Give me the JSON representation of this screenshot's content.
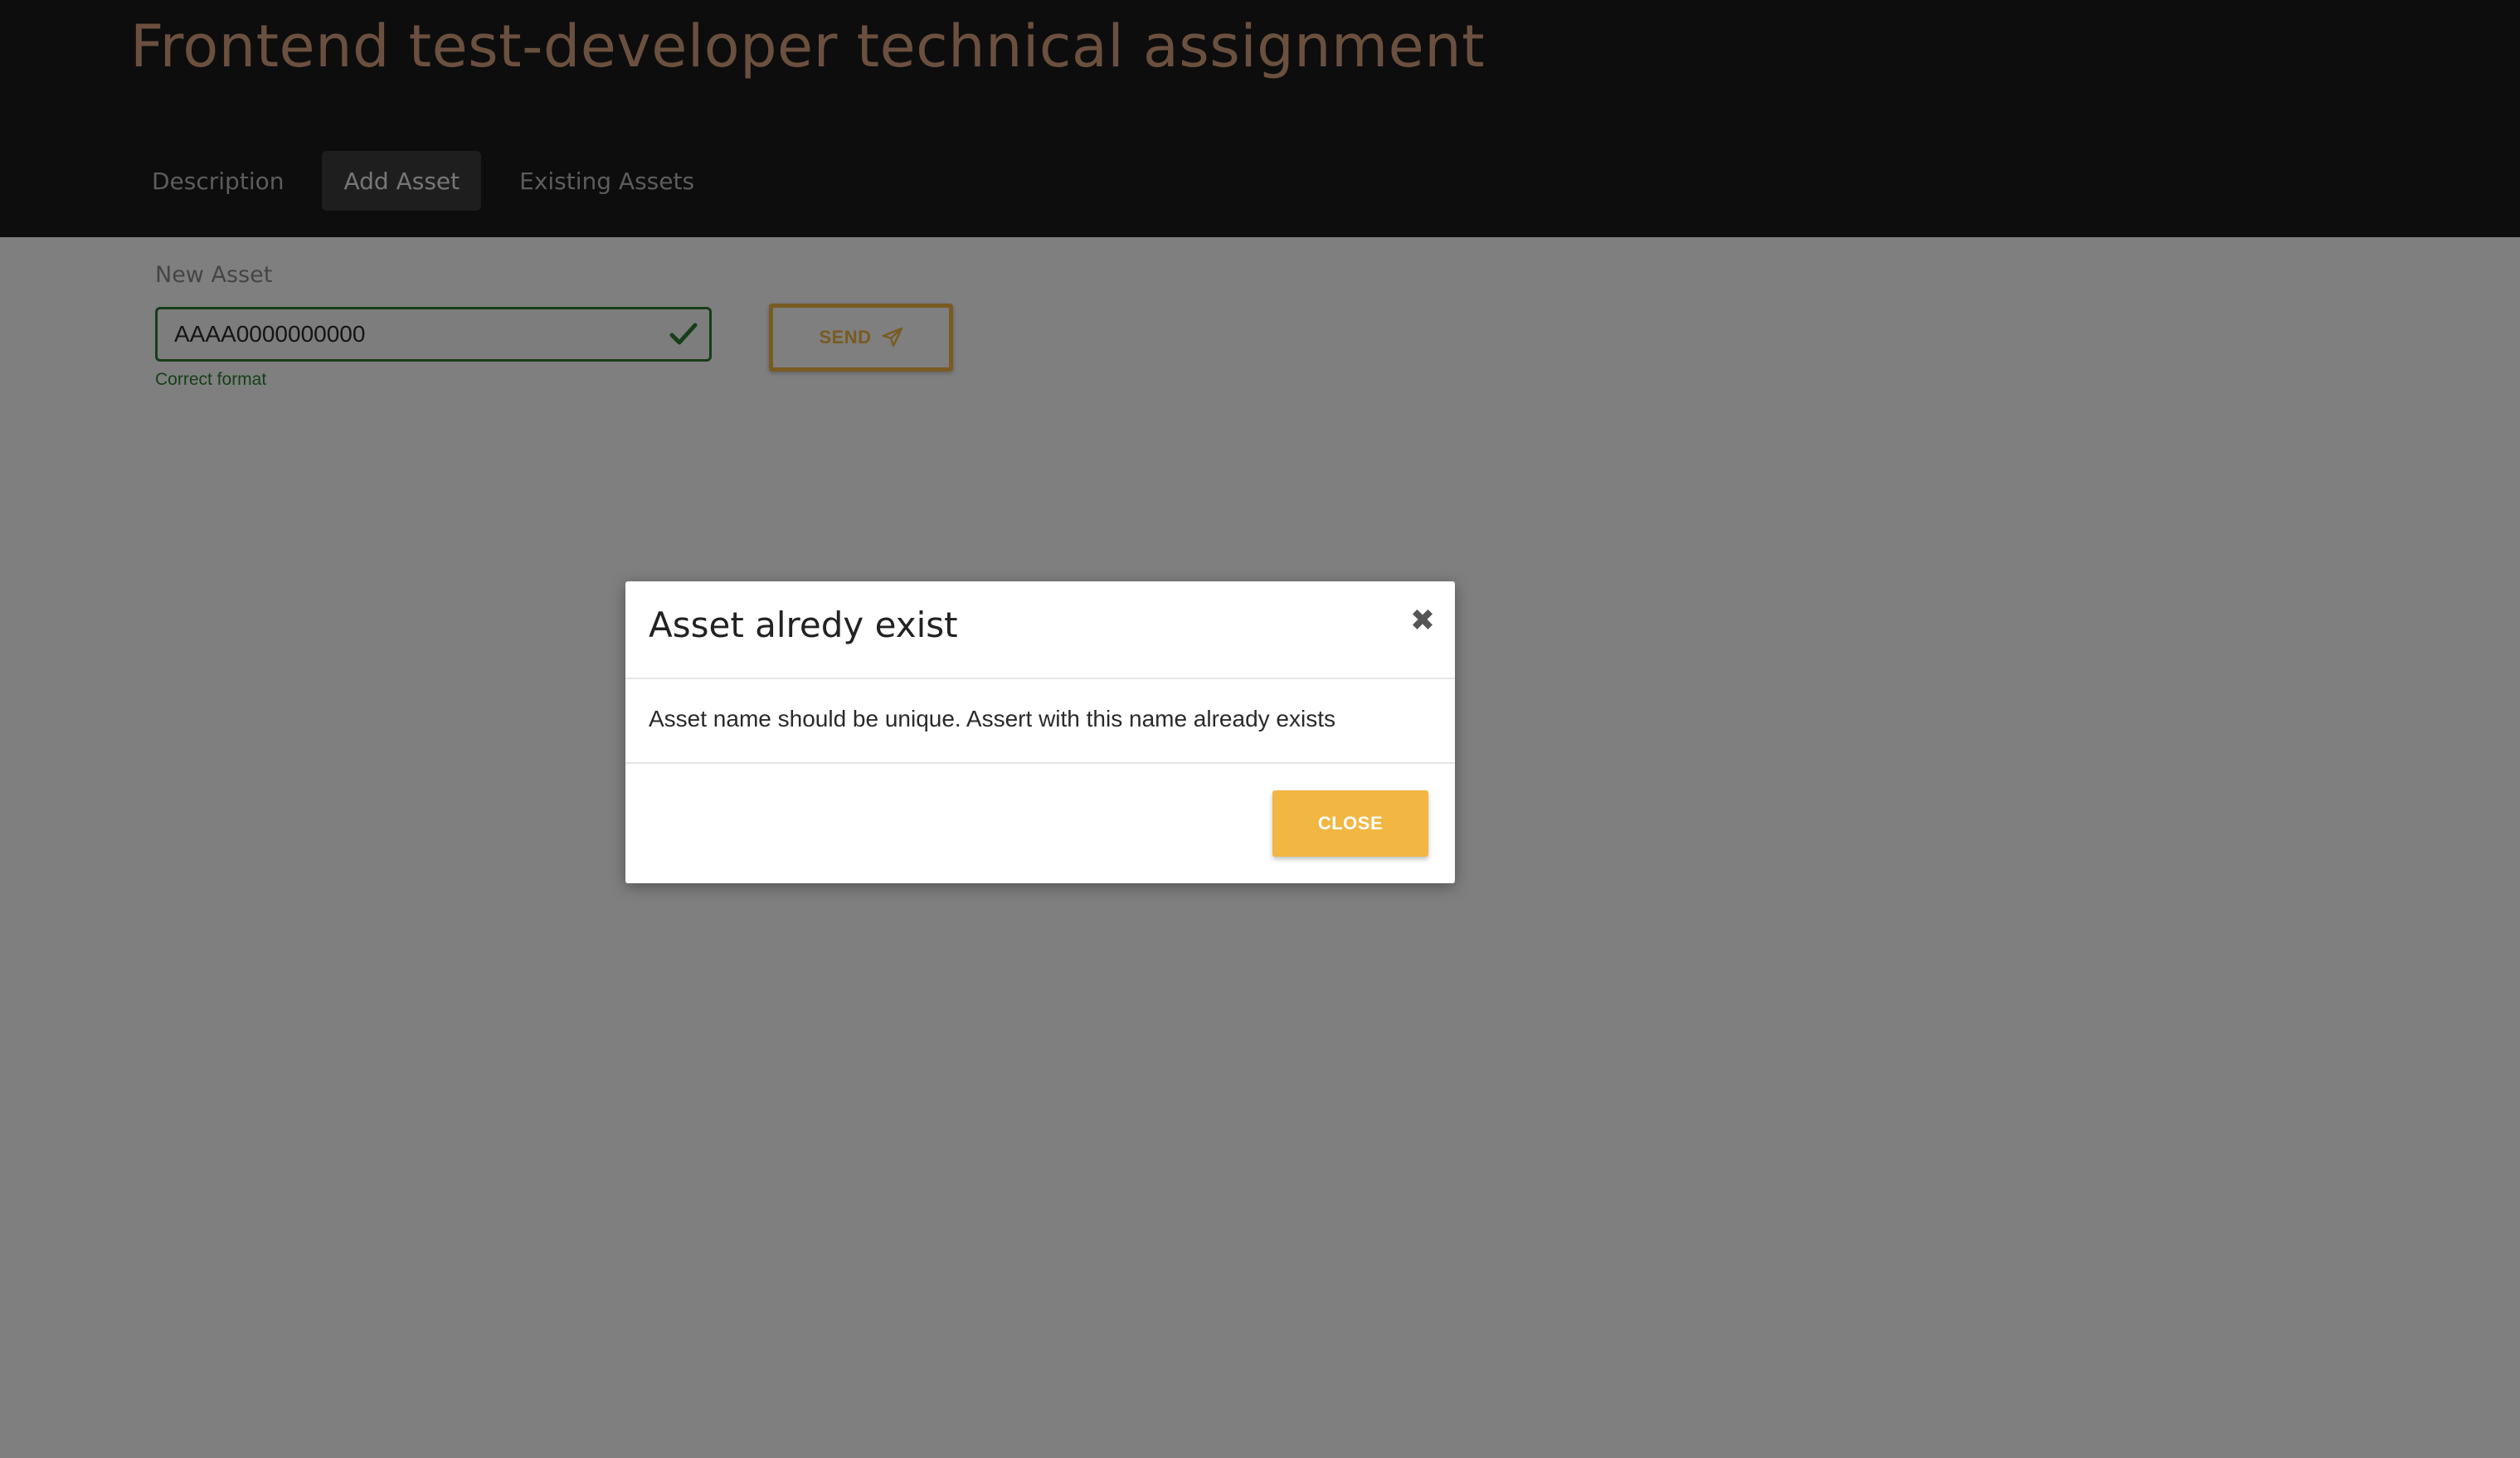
{
  "header": {
    "title": "Frontend test-developer technical assignment",
    "tabs": [
      {
        "label": "Description",
        "active": false
      },
      {
        "label": "Add Asset",
        "active": true
      },
      {
        "label": "Existing Assets",
        "active": false
      }
    ]
  },
  "form": {
    "label": "New Asset",
    "value": "AAAA0000000000",
    "helper": "Correct format",
    "valid": true,
    "send_label": "SEND",
    "send_icon": "paper-plane-icon",
    "valid_icon": "check-icon"
  },
  "modal": {
    "title": "Asset alredy exist",
    "message": "Asset name should be unique. Assert with this name already exists",
    "close_label": "CLOSE",
    "close_icon": "close-icon"
  },
  "colors": {
    "header_bg": "#1b1b1b",
    "title": "#d7a17f",
    "accent": "#f2b642",
    "valid": "#2e7d32"
  }
}
